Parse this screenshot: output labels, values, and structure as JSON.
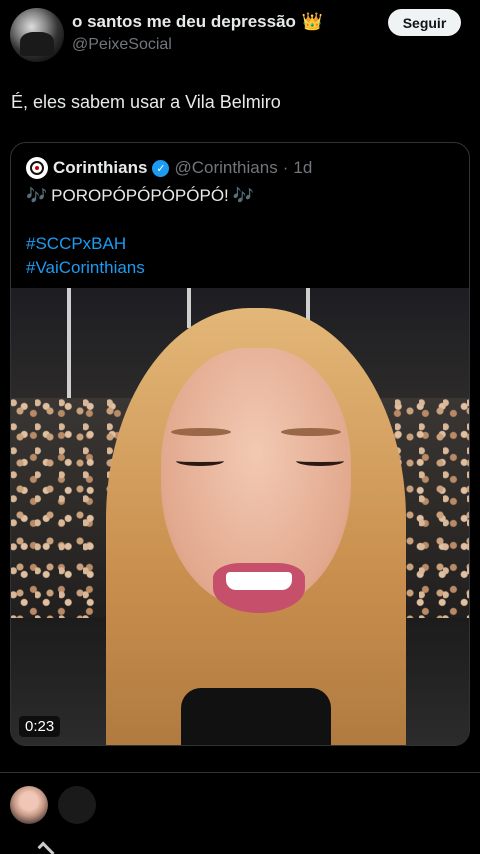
{
  "author": {
    "display_name": "o santos me deu depressão",
    "crown": "👑",
    "handle": "@PeixeSocial",
    "follow_label": "Seguir"
  },
  "tweet": {
    "text": "É, eles sabem usar a Vila Belmiro"
  },
  "quote": {
    "name": "Corinthians",
    "verified": "✓",
    "handle": "@Corinthians",
    "separator": "·",
    "time": "1d",
    "music_icon": "🎶",
    "line1": "POROPÓPÓPÓPÓPÓ!",
    "hashtags": [
      "#SCCPxBAH",
      "#VaiCorinthians"
    ]
  },
  "video": {
    "duration": "0:23"
  },
  "colors": {
    "accent": "#1d9bf0",
    "text": "#e7e9ea",
    "muted": "#71767b",
    "background": "#000000"
  }
}
